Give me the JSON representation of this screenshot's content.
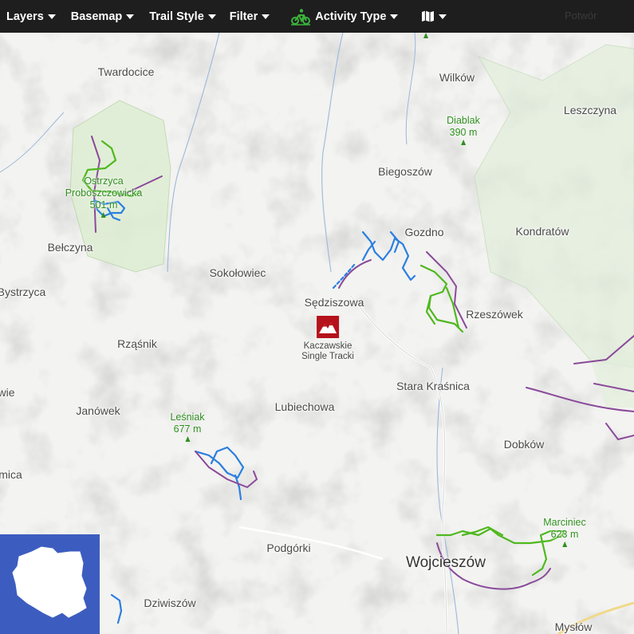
{
  "toolbar": {
    "layers": "Layers",
    "basemap": "Basemap",
    "trail_style": "Trail Style",
    "filter": "Filter",
    "activity_type": "Activity Type",
    "faded_right_text": "Potwór",
    "icons": [
      "caret-down-icon",
      "bike-icon",
      "map-icon"
    ]
  },
  "places": {
    "twardocice": "Twardocice",
    "wilkow": "Wilków",
    "leszczyna": "Leszczyna",
    "biegoszow": "Biegoszów",
    "gozdno": "Gozdno",
    "kondratow": "Kondratów",
    "belczyna": "Bełczyna",
    "sokolowiec": "Sokołowiec",
    "sedziszowa": "Sędziszowa",
    "bystrzyca": "Bystrzyca",
    "rzeszowek": "Rzeszówek",
    "rzasnik": "Rząśnik",
    "stara_krasnica": "Stara Kraśnica",
    "wie": "wie",
    "janowek": "Janówek",
    "lubiechowa": "Lubiechowa",
    "dobkow": "Dobków",
    "mica": "mica",
    "podgorki": "Podgórki",
    "wojcieszow": "Wojcieszów",
    "dziwiszow": "Dziwiszów",
    "myslow": "Mysłów"
  },
  "peaks": {
    "diablak": {
      "name": "Diablak",
      "elevation": "390 m"
    },
    "ostrzyca": {
      "name_line1": "Ostrzyca",
      "name_line2": "Proboszczowicka",
      "elevation": "501 m"
    },
    "lesniak": {
      "name": "Leśniak",
      "elevation": "677 m"
    },
    "marciniec": {
      "name": "Marciniec",
      "elevation": "623 m"
    }
  },
  "poi": {
    "line1": "Kaczawskie",
    "line2": "Single Tracki",
    "icon": "mountain-badge-icon",
    "color": "#b5121b"
  },
  "colors": {
    "toolbar_bg": "#1e1e1e",
    "trail_green": "#4fb81e",
    "trail_blue": "#2a7fe0",
    "trail_purple": "#8a4a9a",
    "forest": "#e1ecd8",
    "minimap_bg": "#3c5dbf"
  },
  "minimap": {
    "icon": "poland-outline-icon"
  }
}
